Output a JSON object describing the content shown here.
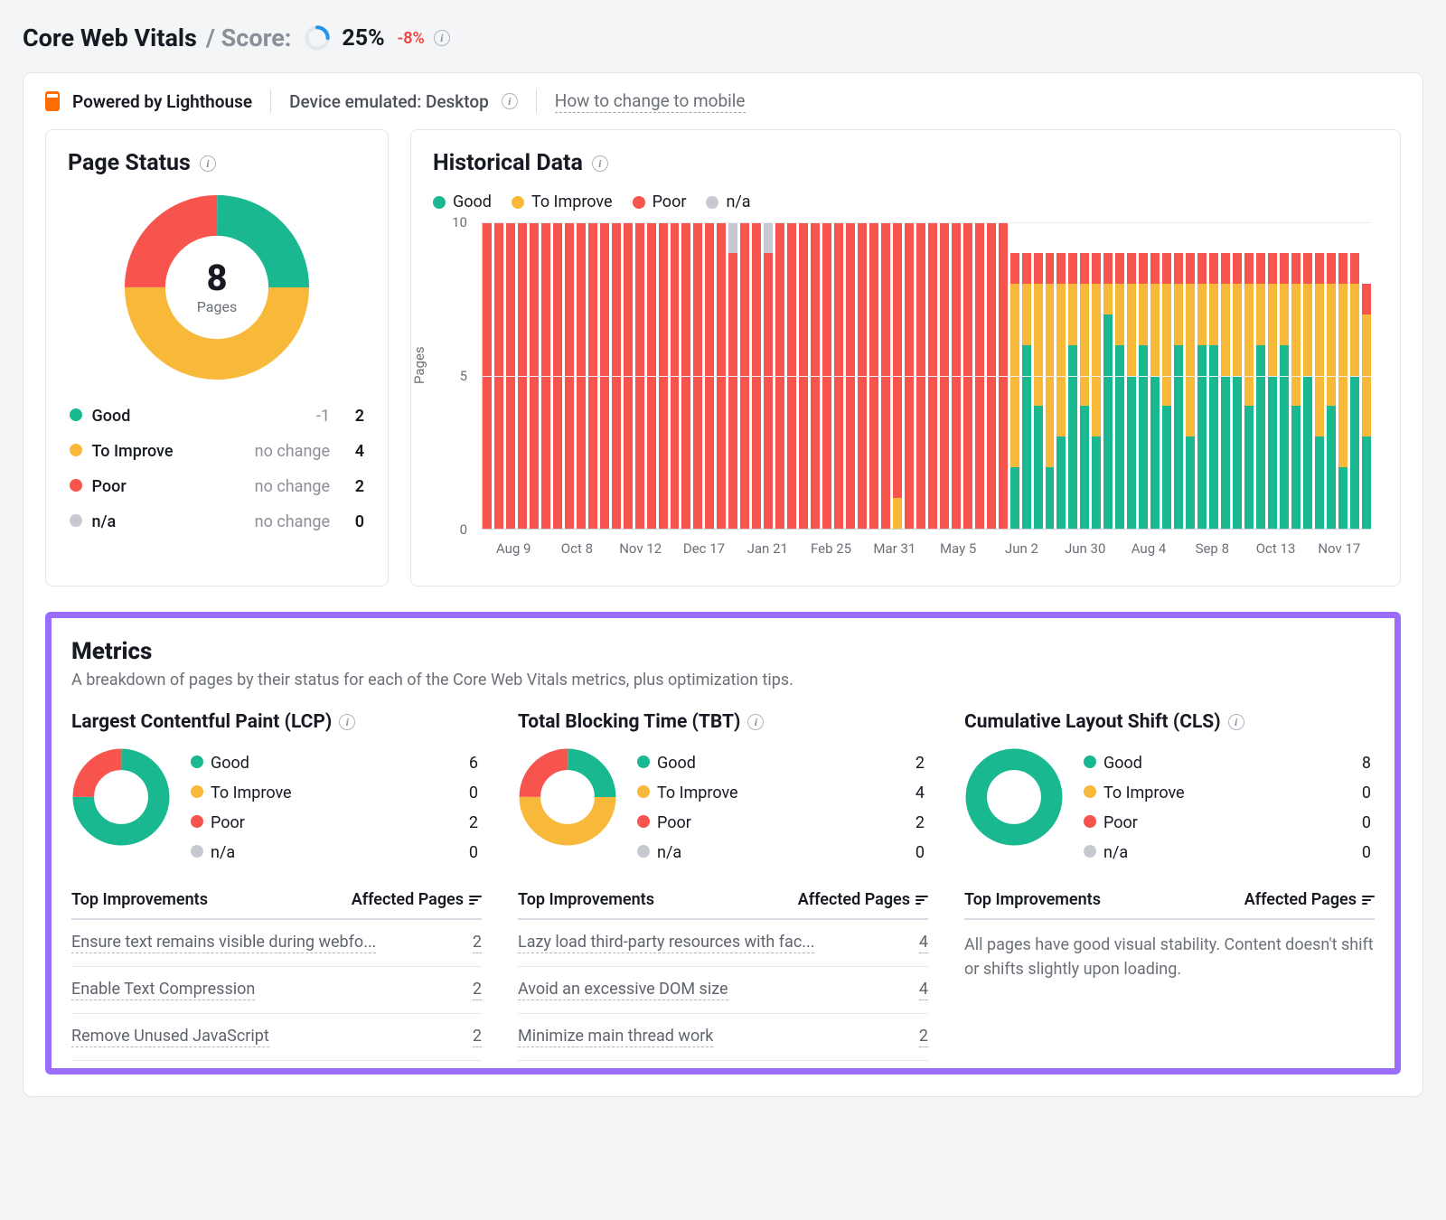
{
  "colors": {
    "good": "#19b891",
    "improve": "#f8b93a",
    "poor": "#f8544e",
    "na": "#c6c9d0",
    "accent": "#2196f3"
  },
  "header": {
    "title": "Core Web Vitals",
    "score_label": "/ Score:",
    "score_pct": "25%",
    "score_value": 25,
    "delta": "-8%"
  },
  "panel_bar": {
    "powered": "Powered by Lighthouse",
    "device": "Device emulated: Desktop",
    "link": "How to change to mobile"
  },
  "page_status": {
    "title": "Page Status",
    "total_pages": "8",
    "total_label": "Pages",
    "segments": {
      "good": 2,
      "to_improve": 4,
      "poor": 2,
      "na": 0
    },
    "rows": [
      {
        "key": "good",
        "label": "Good",
        "change": "-1",
        "value": "2"
      },
      {
        "key": "improve",
        "label": "To Improve",
        "change": "no change",
        "value": "4"
      },
      {
        "key": "poor",
        "label": "Poor",
        "change": "no change",
        "value": "2"
      },
      {
        "key": "na",
        "label": "n/a",
        "change": "no change",
        "value": "0"
      }
    ]
  },
  "historical": {
    "title": "Historical Data",
    "legend": [
      {
        "key": "good",
        "label": "Good"
      },
      {
        "key": "improve",
        "label": "To Improve"
      },
      {
        "key": "poor",
        "label": "Poor"
      },
      {
        "key": "na",
        "label": "n/a"
      }
    ],
    "ylabel": "Pages",
    "ymax": 10,
    "yticks": [
      0,
      5,
      10
    ],
    "xticks": [
      "Aug 9",
      "Oct 8",
      "Nov 12",
      "Dec 17",
      "Jan 21",
      "Feb 25",
      "Mar 31",
      "May 5",
      "Jun 2",
      "Jun 30",
      "Aug 4",
      "Sep 8",
      "Oct 13",
      "Nov 17"
    ]
  },
  "chart_data": {
    "page_status_donut": {
      "type": "pie",
      "title": "Page Status",
      "series": [
        {
          "name": "Good",
          "value": 2,
          "color": "#19b891"
        },
        {
          "name": "To Improve",
          "value": 4,
          "color": "#f8b93a"
        },
        {
          "name": "Poor",
          "value": 2,
          "color": "#f8544e"
        },
        {
          "name": "n/a",
          "value": 0,
          "color": "#c6c9d0"
        }
      ],
      "total": 8
    },
    "historical_bars": {
      "type": "bar",
      "stacked": true,
      "ylabel": "Pages",
      "ylim": [
        0,
        10
      ],
      "xticks": [
        "Aug 9",
        "Oct 8",
        "Nov 12",
        "Dec 17",
        "Jan 21",
        "Feb 25",
        "Mar 31",
        "May 5",
        "Jun 2",
        "Jun 30",
        "Aug 4",
        "Sep 8",
        "Oct 13",
        "Nov 17"
      ],
      "note": "Stacks are [good, to_improve, poor, na]; values estimated from figure.",
      "bars": [
        [
          0,
          0,
          10,
          0
        ],
        [
          0,
          0,
          10,
          0
        ],
        [
          0,
          0,
          10,
          0
        ],
        [
          0,
          0,
          10,
          0
        ],
        [
          0,
          0,
          10,
          0
        ],
        [
          0,
          0,
          10,
          0
        ],
        [
          0,
          0,
          10,
          0
        ],
        [
          0,
          0,
          10,
          0
        ],
        [
          0,
          0,
          10,
          0
        ],
        [
          0,
          0,
          10,
          0
        ],
        [
          0,
          0,
          10,
          0
        ],
        [
          0,
          0,
          10,
          0
        ],
        [
          0,
          0,
          10,
          0
        ],
        [
          0,
          0,
          10,
          0
        ],
        [
          0,
          0,
          10,
          0
        ],
        [
          0,
          0,
          10,
          0
        ],
        [
          0,
          0,
          10,
          0
        ],
        [
          0,
          0,
          10,
          0
        ],
        [
          0,
          0,
          10,
          0
        ],
        [
          0,
          0,
          10,
          0
        ],
        [
          0,
          0,
          10,
          0
        ],
        [
          0,
          0,
          9,
          1
        ],
        [
          0,
          0,
          10,
          0
        ],
        [
          0,
          0,
          10,
          0
        ],
        [
          0,
          0,
          9,
          1
        ],
        [
          0,
          0,
          10,
          0
        ],
        [
          0,
          0,
          10,
          0
        ],
        [
          0,
          0,
          10,
          0
        ],
        [
          0,
          0,
          10,
          0
        ],
        [
          0,
          0,
          10,
          0
        ],
        [
          0,
          0,
          10,
          0
        ],
        [
          0,
          0,
          10,
          0
        ],
        [
          0,
          0,
          10,
          0
        ],
        [
          0,
          0,
          10,
          0
        ],
        [
          0,
          0,
          10,
          0
        ],
        [
          0,
          1,
          9,
          0
        ],
        [
          0,
          0,
          10,
          0
        ],
        [
          0,
          0,
          10,
          0
        ],
        [
          0,
          0,
          10,
          0
        ],
        [
          0,
          0,
          10,
          0
        ],
        [
          0,
          0,
          10,
          0
        ],
        [
          0,
          0,
          10,
          0
        ],
        [
          0,
          0,
          10,
          0
        ],
        [
          0,
          0,
          10,
          0
        ],
        [
          0,
          0,
          10,
          0
        ],
        [
          2,
          6,
          1,
          0
        ],
        [
          6,
          2,
          1,
          0
        ],
        [
          4,
          4,
          1,
          0
        ],
        [
          2,
          6,
          1,
          0
        ],
        [
          3,
          5,
          1,
          0
        ],
        [
          6,
          2,
          1,
          0
        ],
        [
          4,
          4,
          1,
          0
        ],
        [
          3,
          5,
          1,
          0
        ],
        [
          7,
          1,
          1,
          0
        ],
        [
          6,
          2,
          1,
          0
        ],
        [
          5,
          3,
          1,
          0
        ],
        [
          6,
          2,
          1,
          0
        ],
        [
          5,
          3,
          1,
          0
        ],
        [
          4,
          4,
          1,
          0
        ],
        [
          6,
          2,
          1,
          0
        ],
        [
          3,
          5,
          1,
          0
        ],
        [
          6,
          2,
          1,
          0
        ],
        [
          6,
          2,
          1,
          0
        ],
        [
          5,
          3,
          1,
          0
        ],
        [
          5,
          3,
          1,
          0
        ],
        [
          4,
          4,
          1,
          0
        ],
        [
          6,
          2,
          1,
          0
        ],
        [
          5,
          3,
          1,
          0
        ],
        [
          6,
          2,
          1,
          0
        ],
        [
          4,
          4,
          1,
          0
        ],
        [
          5,
          3,
          1,
          0
        ],
        [
          3,
          5,
          1,
          0
        ],
        [
          4,
          4,
          1,
          0
        ],
        [
          2,
          6,
          1,
          0
        ],
        [
          5,
          3,
          1,
          0
        ],
        [
          3,
          4,
          1,
          0
        ]
      ]
    },
    "metric_donuts": {
      "lcp": {
        "type": "pie",
        "series": [
          {
            "name": "Good",
            "value": 6
          },
          {
            "name": "To Improve",
            "value": 0
          },
          {
            "name": "Poor",
            "value": 2
          },
          {
            "name": "n/a",
            "value": 0
          }
        ]
      },
      "tbt": {
        "type": "pie",
        "series": [
          {
            "name": "Good",
            "value": 2
          },
          {
            "name": "To Improve",
            "value": 4
          },
          {
            "name": "Poor",
            "value": 2
          },
          {
            "name": "n/a",
            "value": 0
          }
        ]
      },
      "cls": {
        "type": "pie",
        "series": [
          {
            "name": "Good",
            "value": 8
          },
          {
            "name": "To Improve",
            "value": 0
          },
          {
            "name": "Poor",
            "value": 0
          },
          {
            "name": "n/a",
            "value": 0
          }
        ]
      }
    }
  },
  "metrics": {
    "title": "Metrics",
    "subtitle": "A breakdown of pages by their status for each of the Core Web Vitals metrics, plus optimization tips.",
    "improvements_label": "Top Improvements",
    "affected_label": "Affected Pages",
    "cols": [
      {
        "key": "lcp",
        "title": "Largest Contentful Paint (LCP)",
        "rows": [
          {
            "key": "good",
            "label": "Good",
            "value": "6"
          },
          {
            "key": "improve",
            "label": "To Improve",
            "value": "0"
          },
          {
            "key": "poor",
            "label": "Poor",
            "value": "2"
          },
          {
            "key": "na",
            "label": "n/a",
            "value": "0"
          }
        ],
        "improvements": [
          {
            "text": "Ensure text remains visible during webfo...",
            "value": "2"
          },
          {
            "text": "Enable Text Compression",
            "value": "2"
          },
          {
            "text": "Remove Unused JavaScript",
            "value": "2"
          }
        ]
      },
      {
        "key": "tbt",
        "title": "Total Blocking Time (TBT)",
        "rows": [
          {
            "key": "good",
            "label": "Good",
            "value": "2"
          },
          {
            "key": "improve",
            "label": "To Improve",
            "value": "4"
          },
          {
            "key": "poor",
            "label": "Poor",
            "value": "2"
          },
          {
            "key": "na",
            "label": "n/a",
            "value": "0"
          }
        ],
        "improvements": [
          {
            "text": "Lazy load third-party resources with fac...",
            "value": "4"
          },
          {
            "text": "Avoid an excessive DOM size",
            "value": "4"
          },
          {
            "text": "Minimize main thread work",
            "value": "2"
          }
        ]
      },
      {
        "key": "cls",
        "title": "Cumulative Layout Shift (CLS)",
        "rows": [
          {
            "key": "good",
            "label": "Good",
            "value": "8"
          },
          {
            "key": "improve",
            "label": "To Improve",
            "value": "0"
          },
          {
            "key": "poor",
            "label": "Poor",
            "value": "0"
          },
          {
            "key": "na",
            "label": "n/a",
            "value": "0"
          }
        ],
        "message": "All pages have good visual stability. Content doesn't shift or shifts slightly upon loading."
      }
    ]
  }
}
